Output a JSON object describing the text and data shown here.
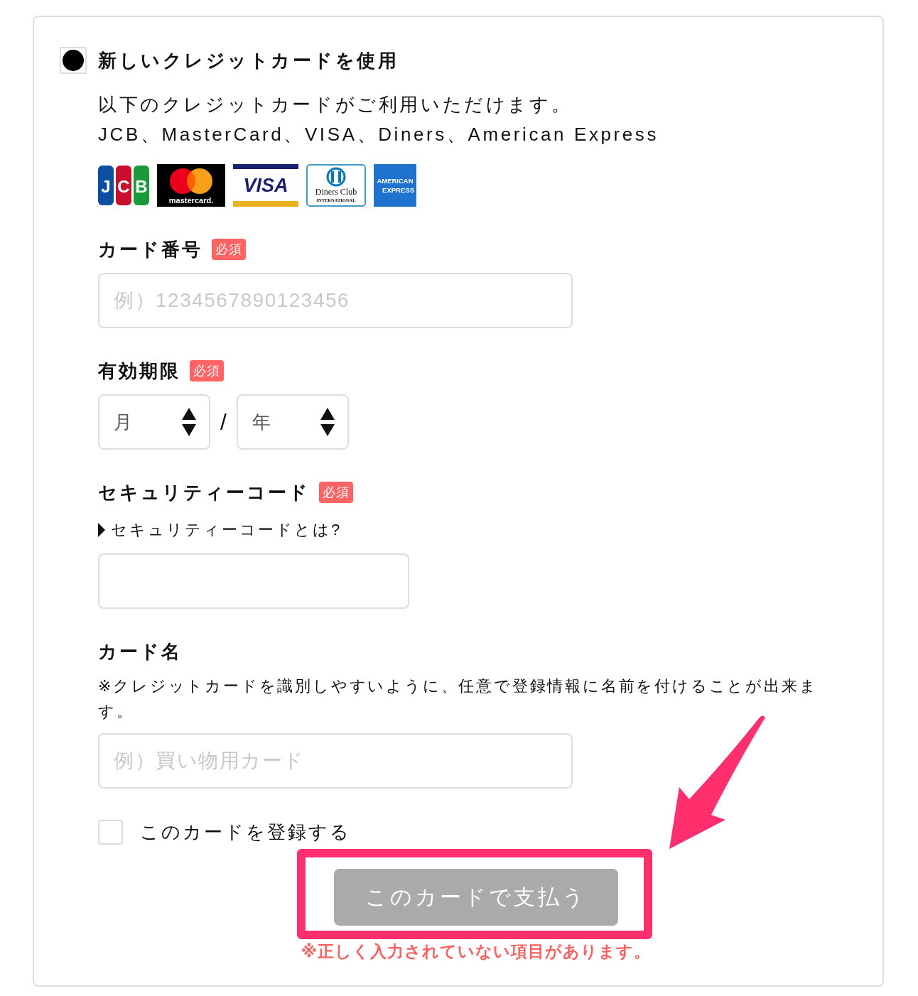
{
  "payment_option": {
    "label": "新しいクレジットカードを使用",
    "selected": true
  },
  "intro": {
    "lines": [
      "以下のクレジットカードがご利用いただけます。",
      "JCB、MasterCard、VISA、Diners、American Express"
    ]
  },
  "card_brands": [
    {
      "kind": "jcb",
      "texts": [
        "JCB"
      ]
    },
    {
      "kind": "mastercard",
      "texts": [
        "mastercard."
      ]
    },
    {
      "kind": "visa",
      "texts": [
        "VISA"
      ]
    },
    {
      "kind": "diners",
      "texts": [
        "Diners Club",
        "INTERNATIONAL"
      ]
    },
    {
      "kind": "amex",
      "texts": [
        "AMERICAN",
        "EXPRESS"
      ]
    }
  ],
  "fields": [
    {
      "kind": "text",
      "label": "カード番号",
      "badge": "必須",
      "placeholder": "例）1234567890123456"
    },
    {
      "kind": "expiry",
      "label": "有効期限",
      "badge": "必須",
      "selects": [
        {
          "value": "月"
        },
        {
          "value": "年"
        }
      ],
      "separator": "/"
    },
    {
      "kind": "code",
      "label": "セキュリティーコード",
      "badge": "必須",
      "link": "セキュリティーコードとは?"
    },
    {
      "kind": "text",
      "label": "カード名",
      "note": "※クレジットカードを識別しやすいように、任意で登録情報に名前を付けることが出来ます。",
      "placeholder": "例）買い物用カード"
    }
  ],
  "save_option": {
    "label": "このカードを登録する",
    "checked": false
  },
  "submit": {
    "label": "このカードで支払う",
    "disabled": true
  },
  "error": "※正しく入力されていない項目があります。"
}
